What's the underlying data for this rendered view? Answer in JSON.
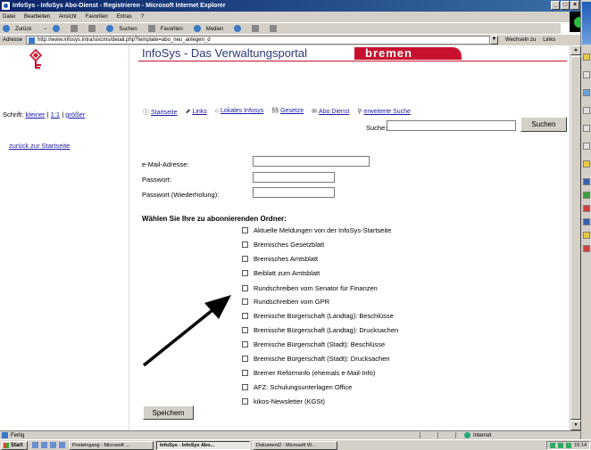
{
  "window": {
    "title": "InfoSys - InfoSys Abo-Dienst - Registrieren - Microsoft Internet Explorer",
    "controls": [
      "_",
      "□",
      "×"
    ]
  },
  "menubar": {
    "items": [
      "Datei",
      "Bearbeiten",
      "Ansicht",
      "Favoriten",
      "Extras",
      "?"
    ]
  },
  "toolbar": {
    "back": "Zurück",
    "forward": "→",
    "search": "Suchen",
    "favorites": "Favoriten",
    "media": "Medien"
  },
  "addressbar": {
    "label": "Adresse",
    "url": "http://www.infosys.intra/sixcms/detail.php?template=abo_neu_anlegen_d",
    "go": "Wechseln zu",
    "links": "Links"
  },
  "left": {
    "schrift_label": "Schrift:",
    "kleiner": "kleiner",
    "sep1": "|",
    "normal": "1:1",
    "sep2": "|",
    "groesser": "größer",
    "back_link": "zurück zur Startseite"
  },
  "header": {
    "title": "InfoSys - Das Verwaltungsportal",
    "brand": "bremen"
  },
  "nav": {
    "links": [
      {
        "icon": "ⓘ",
        "label": "Startseite"
      },
      {
        "icon": "⬈",
        "label": "Links"
      },
      {
        "icon": "⌂",
        "label": "Lokales Infosys"
      },
      {
        "icon": "§§",
        "label": "Gesetze"
      },
      {
        "icon": "✉",
        "label": "Abo Dienst"
      },
      {
        "icon": "⚲",
        "label": "erweiterte Suche"
      }
    ]
  },
  "search": {
    "label": "Suche:",
    "value": "",
    "button": "Suchen"
  },
  "form": {
    "email_label": "e-Mail-Adresse:",
    "password_label": "Passwort:",
    "password_repeat_label": "Passwort (Wiederholung):",
    "section_title": "Wählen Sie Ihre zu abonnierenden Ordner:",
    "folders": [
      "Aktuelle Meldungen von der InfoSys-Startseite",
      "Bremisches Gesetzblatt",
      "Bremisches Amtsblatt",
      "Beiblatt zum Amtsblatt",
      "Rundschreiben vom Senator für Finanzen",
      "Rundschreiben vom GPR",
      "Bremische Bürgerschaft (Landtag): Beschlüsse",
      "Bremische Bürgerschaft (Landtag): Drucksachen",
      "Bremische Bürgerschaft (Stadt): Beschlüsse",
      "Bremische Bürgerschaft (Stadt): Drucksachen",
      "Bremer Reforminfo (ehemals e-Mail-Info)",
      "AFZ: Schulungsunterlagen Office",
      "kikos-Newsletter (KGSt)"
    ],
    "save_button": "Speichern"
  },
  "statusbar": {
    "status": "Fertig",
    "zone": "Internet"
  },
  "taskbar": {
    "start": "Start",
    "tasks": [
      {
        "label": "Posteingang - Microsoft ...",
        "active": false
      },
      {
        "label": "InfoSys - InfoSys Abo...",
        "active": true
      },
      {
        "label": "Dokument2 - Microsoft W...",
        "active": false
      }
    ],
    "clock": "15:14"
  },
  "colors": {
    "title_blue": "#2a3a78",
    "bremen_red": "#c8102e",
    "link_blue": "#1a1aa6",
    "chrome_gray": "#d4d0c8"
  }
}
